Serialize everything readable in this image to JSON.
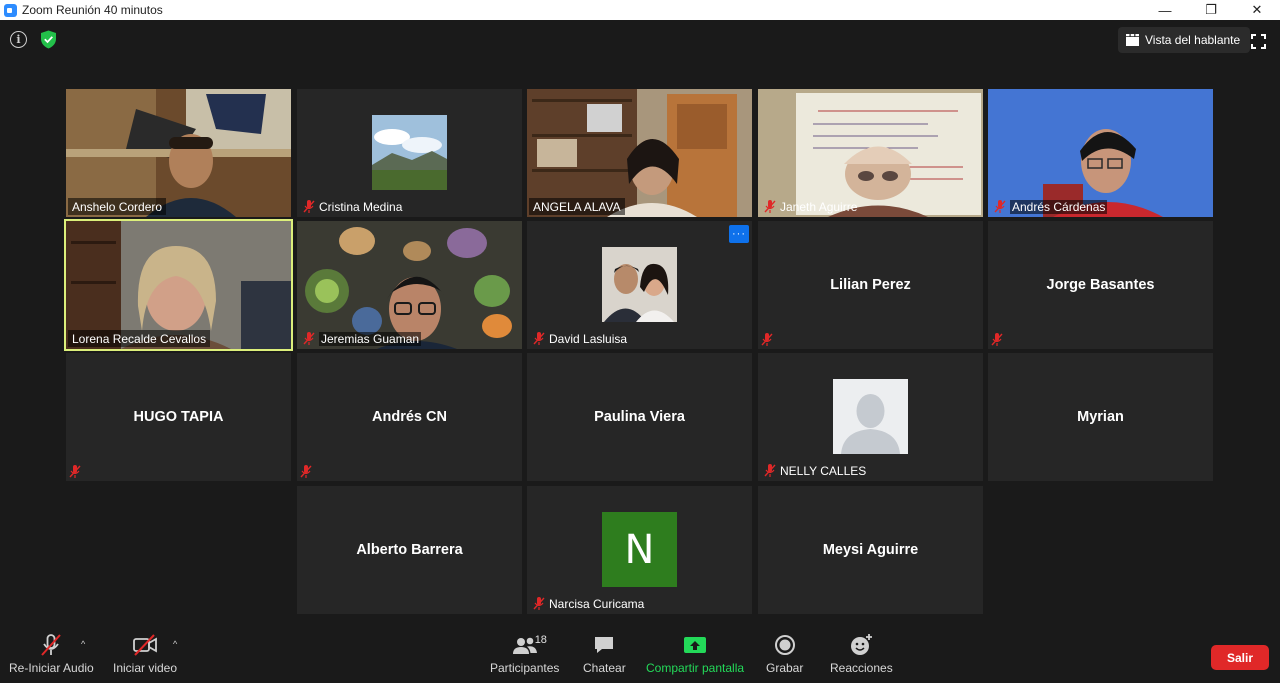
{
  "window": {
    "title": "Zoom Reunión 40 minutos",
    "controls": {
      "minimize": "—",
      "restore": "❐",
      "close": "✕"
    }
  },
  "topbar": {
    "speaker_view_label": "Vista del hablante"
  },
  "participants_grid": [
    {
      "name": "Anshelo Cordero",
      "muted": false,
      "video": true
    },
    {
      "name": "Cristina Medina",
      "muted": true,
      "video": false,
      "photo": "landscape"
    },
    {
      "name": "ANGELA ALAVA",
      "muted": false,
      "video": true
    },
    {
      "name": "Janeth Aguirre",
      "muted": true,
      "video": true
    },
    {
      "name": "Andrés Cárdenas",
      "muted": true,
      "video": true
    },
    {
      "name": "Lorena Recalde Cevallos",
      "muted": false,
      "video": true,
      "active_speaker": true
    },
    {
      "name": "Jeremias Guaman",
      "muted": true,
      "video": true
    },
    {
      "name": "David Lasluisa",
      "muted": true,
      "video": false,
      "photo": "couple",
      "more_menu": "···"
    },
    {
      "name": "Lilian Perez",
      "muted": true,
      "video": false
    },
    {
      "name": "Jorge Basantes",
      "muted": true,
      "video": false
    },
    {
      "name": "HUGO TAPIA",
      "muted": true,
      "video": false
    },
    {
      "name": "Andrés CN",
      "muted": true,
      "video": false
    },
    {
      "name": "Paulina Viera",
      "muted": false,
      "video": false
    },
    {
      "name": "NELLY CALLES",
      "muted": true,
      "video": false,
      "photo": "default-avatar"
    },
    {
      "name": "Myrian",
      "muted": false,
      "video": false
    },
    {
      "name": "Alberto Barrera",
      "muted": false,
      "video": false
    },
    {
      "name": "Narcisa Curicama",
      "muted": true,
      "video": false,
      "initial": "N",
      "initial_color": "#2e7d1e"
    },
    {
      "name": "Meysi Aguirre",
      "muted": false,
      "video": false
    }
  ],
  "toolbar": {
    "audio_label": "Re-Iniciar Audio",
    "video_label": "Iniciar video",
    "participants_label": "Participantes",
    "participants_count": "18",
    "chat_label": "Chatear",
    "share_label": "Compartir pantalla",
    "record_label": "Grabar",
    "reactions_label": "Reacciones",
    "exit_label": "Salir",
    "caret": "^"
  },
  "colors": {
    "background": "#1a1a1a",
    "tile": "#262626",
    "active_speaker_border": "#dcef7b",
    "mute_red": "#e02828",
    "share_green": "#23d959",
    "exit_red": "#e02828",
    "accent_blue": "#0e71eb"
  }
}
